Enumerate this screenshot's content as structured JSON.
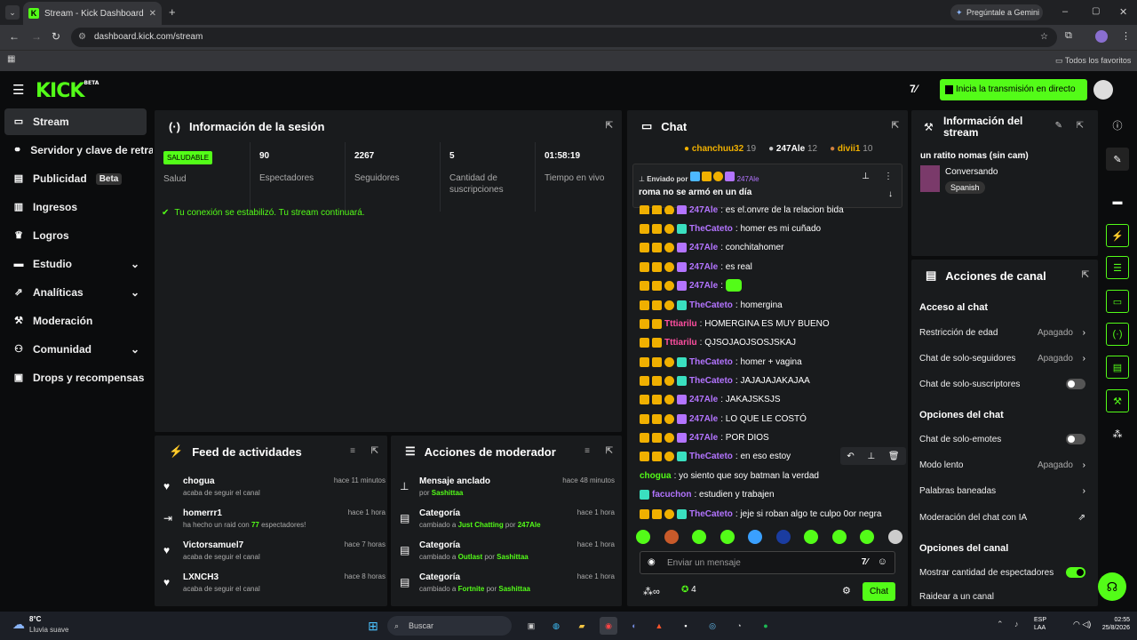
{
  "browser": {
    "tab_title": "Stream - Kick Dashboard",
    "url": "dashboard.kick.com/stream",
    "gemini": "Pregúntale a Gemini",
    "favorites": "Todos los favoritos"
  },
  "app": {
    "logo": "KICK",
    "logo_beta": "BETA",
    "live_button": "Inicia la transmisión en directo"
  },
  "sidebar": {
    "items": [
      {
        "label": "Stream"
      },
      {
        "label": "Servidor y clave de retransmisión"
      },
      {
        "label": "Publicidad",
        "badge": "Beta"
      },
      {
        "label": "Ingresos"
      },
      {
        "label": "Logros"
      },
      {
        "label": "Estudio"
      },
      {
        "label": "Analíticas"
      },
      {
        "label": "Moderación"
      },
      {
        "label": "Comunidad"
      },
      {
        "label": "Drops y recompensas"
      }
    ]
  },
  "session": {
    "title": "Información de la sesión",
    "health": "SALUDABLE",
    "health_label": "Salud",
    "stats": [
      {
        "value": "90",
        "label": "Espectadores"
      },
      {
        "value": "2267",
        "label": "Seguidores"
      },
      {
        "value": "5",
        "label": "Cantidad de suscripciones"
      },
      {
        "value": "01:58:19",
        "label": "Tiempo en vivo"
      }
    ],
    "status": "Tu conexión se estabilizó. Tu stream continuará."
  },
  "feed": {
    "title": "Feed de actividades",
    "items": [
      {
        "name": "chogua",
        "sub": "acaba de seguir el canal",
        "time": "hace 11 minutos"
      },
      {
        "name": "homerrr1",
        "sub_pre": "ha hecho un raid con ",
        "sub_num": "77",
        "sub_post": " espectadores!",
        "time": "hace 1 hora"
      },
      {
        "name": "Victorsamuel7",
        "sub": "acaba de seguir el canal",
        "time": "hace 7 horas"
      },
      {
        "name": "LXNCH3",
        "sub": "acaba de seguir el canal",
        "time": "hace 8 horas"
      }
    ]
  },
  "modactions": {
    "title": "Acciones de moderador",
    "items": [
      {
        "name": "Mensaje anclado",
        "pre": "por ",
        "a": "Sashittaa",
        "mid": "",
        "b": "",
        "time": "hace 48 minutos"
      },
      {
        "name": "Categoría",
        "pre": "cambiado a ",
        "a": "Just Chatting",
        "mid": " por ",
        "b": "247Ale",
        "time": "hace 1 hora"
      },
      {
        "name": "Categoría",
        "pre": "cambiado a ",
        "a": "Outlast",
        "mid": " por ",
        "b": "Sashittaa",
        "time": "hace 1 hora"
      },
      {
        "name": "Categoría",
        "pre": "cambiado a ",
        "a": "Fortnite",
        "mid": " por ",
        "b": "Sashittaa",
        "time": "hace 1 hora"
      }
    ]
  },
  "chat": {
    "title": "Chat",
    "top": [
      {
        "name": "chanchuu32",
        "n": "19"
      },
      {
        "name": "247Ale",
        "n": "12"
      },
      {
        "name": "divii1",
        "n": "10"
      }
    ],
    "pinned": {
      "sent_by": "Enviado por",
      "user": "247Ale",
      "text": "roma no se armó en un día"
    },
    "messages": [
      {
        "user": "247Ale",
        "color": "#b374ff",
        "text": ": es el.onvre de la relacion bida"
      },
      {
        "user": "TheCateto",
        "color": "#b374ff",
        "text": ": homer es mi cuñado"
      },
      {
        "user": "247Ale",
        "color": "#b374ff",
        "text": ": conchitahomer"
      },
      {
        "user": "247Ale",
        "color": "#b374ff",
        "text": ": es real"
      },
      {
        "user": "247Ale",
        "color": "#b374ff",
        "text": ": "
      },
      {
        "user": "TheCateto",
        "color": "#b374ff",
        "text": ": homergina"
      },
      {
        "user": "Tttiarilu",
        "color": "#ff4fa0",
        "text": ": HOMERGINA ES MUY BUENO"
      },
      {
        "user": "Tttiarilu",
        "color": "#ff4fa0",
        "text": ": QJSOJAOJSOSJSKAJ"
      },
      {
        "user": "TheCateto",
        "color": "#b374ff",
        "text": ": homer + vagina"
      },
      {
        "user": "TheCateto",
        "color": "#b374ff",
        "text": ": JAJAJAJAKAJAA"
      },
      {
        "user": "247Ale",
        "color": "#b374ff",
        "text": ": JAKAJSKSJS"
      },
      {
        "user": "247Ale",
        "color": "#b374ff",
        "text": ": LO QUE LE COSTÓ"
      },
      {
        "user": "247Ale",
        "color": "#b374ff",
        "text": ": POR DIOS"
      },
      {
        "user": "TheCateto",
        "color": "#b374ff",
        "text": ": en eso estoy"
      },
      {
        "user": "chogua",
        "color": "#53fc18",
        "text": ": yo siento que soy batman la verdad"
      },
      {
        "user": "facuchon",
        "color": "#b374ff",
        "text": ": estudien y trabajen"
      },
      {
        "user": "TheCateto",
        "color": "#b374ff",
        "text": ": jeje si roban algo te culpo 0or negra"
      }
    ],
    "input_placeholder": "Enviar un mensaje",
    "viewers": "4",
    "send": "Chat"
  },
  "streaminfo": {
    "title": "Información del stream",
    "stream_title": "un ratito nomas (sin cam)",
    "category": "Conversando",
    "language": "Spanish"
  },
  "channel": {
    "title": "Acciones de canal",
    "access": "Acceso al chat",
    "rows1": [
      {
        "label": "Restricción de edad",
        "value": "Apagado"
      },
      {
        "label": "Chat de solo-seguidores",
        "value": "Apagado"
      },
      {
        "label": "Chat de solo-suscriptores",
        "value": ""
      }
    ],
    "chat_options": "Opciones del chat",
    "rows2": [
      {
        "label": "Chat de solo-emotes",
        "value": ""
      },
      {
        "label": "Modo lento",
        "value": "Apagado"
      },
      {
        "label": "Palabras baneadas",
        "value": ""
      },
      {
        "label": "Moderación del chat con IA",
        "value": ""
      }
    ],
    "channel_options": "Opciones del canal",
    "rows3": [
      {
        "label": "Mostrar cantidad de espectadores",
        "value": ""
      },
      {
        "label": "Raidear a un canal",
        "value": ""
      }
    ]
  },
  "taskbar": {
    "temp": "8°C",
    "weather": "Lluvia suave",
    "search": "Buscar",
    "lang1": "ESP",
    "lang2": "LAA",
    "time": "02:55",
    "date": "25/8/2026"
  }
}
